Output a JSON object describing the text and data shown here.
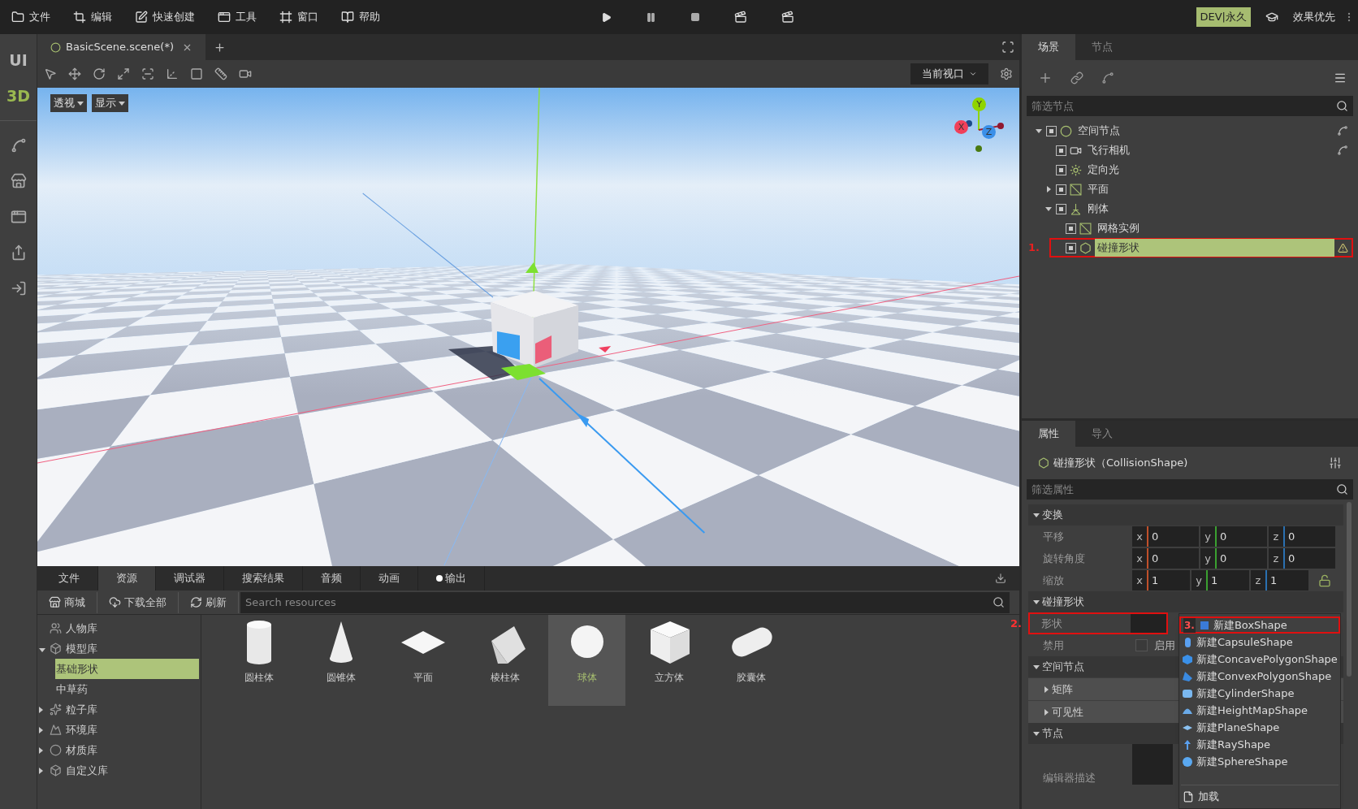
{
  "menu_bar": {
    "items": [
      {
        "label": "文件"
      },
      {
        "label": "编辑"
      },
      {
        "label": "快速创建"
      },
      {
        "label": "工具"
      },
      {
        "label": "窗口"
      },
      {
        "label": "帮助"
      }
    ],
    "license_badge": "DEV|永久",
    "quality": "效果优先"
  },
  "mode_rail": [
    {
      "label": "UI",
      "selected": false
    },
    {
      "label": "3D",
      "selected": true
    }
  ],
  "editor": {
    "tabs": [
      {
        "label": "BasicScene.scene(*)",
        "selected": true
      }
    ],
    "viewport_select": "当前视口",
    "view_buttons": [
      "透视",
      "显示"
    ],
    "gizmo_axes": [
      {
        "label": "Y",
        "color": "#8fd400"
      },
      {
        "label": "X",
        "color": "#f0405a"
      },
      {
        "label": "Z",
        "color": "#3a8fe8"
      }
    ]
  },
  "bottom_panel": {
    "tabs": [
      {
        "label": "文件",
        "selected": false,
        "unread": false
      },
      {
        "label": "资源",
        "selected": true,
        "unread": false
      },
      {
        "label": "调试器",
        "selected": false,
        "unread": false
      },
      {
        "label": "搜索结果",
        "selected": false,
        "unread": false
      },
      {
        "label": "音频",
        "selected": false,
        "unread": false
      },
      {
        "label": "动画",
        "selected": false,
        "unread": false
      },
      {
        "label": "输出",
        "selected": false,
        "unread": true
      }
    ],
    "toolbar": [
      {
        "label": "商城"
      },
      {
        "label": "下载全部"
      },
      {
        "label": "刷新"
      }
    ],
    "search": {
      "placeholder": "Search resources"
    },
    "library": [
      {
        "label": "人物库",
        "selected": false
      },
      {
        "label": "模型库",
        "expanded": true,
        "selected": false,
        "children": [
          {
            "label": "基础形状",
            "selected": true
          },
          {
            "label": "中草药",
            "selected": false
          }
        ]
      },
      {
        "label": "粒子库",
        "expanded": false,
        "selected": false
      },
      {
        "label": "环境库",
        "expanded": false,
        "selected": false
      },
      {
        "label": "材质库",
        "expanded": false,
        "selected": false
      },
      {
        "label": "自定义库",
        "expanded": false,
        "selected": false
      }
    ],
    "assets": [
      {
        "label": "圆柱体",
        "kind": "cylinder",
        "selected": false
      },
      {
        "label": "圆锥体",
        "kind": "cone",
        "selected": false
      },
      {
        "label": "平面",
        "kind": "plane",
        "selected": false
      },
      {
        "label": "棱柱体",
        "kind": "prism",
        "selected": false
      },
      {
        "label": "球体",
        "kind": "sphere",
        "selected": true
      },
      {
        "label": "立方体",
        "kind": "cube",
        "selected": false
      },
      {
        "label": "胶囊体",
        "kind": "capsule",
        "selected": false
      }
    ]
  },
  "scene_panel": {
    "tabs": [
      {
        "label": "场景",
        "selected": true
      },
      {
        "label": "节点",
        "selected": false
      }
    ],
    "filter": {
      "placeholder": "筛选节点"
    },
    "tree": [
      {
        "label": "空间节点",
        "kind": "spatial",
        "visible": true,
        "expanded": true,
        "selected": false,
        "linked": true,
        "children": [
          {
            "label": "飞行相机",
            "kind": "camera",
            "visible": true,
            "selected": false,
            "linked": true
          },
          {
            "label": "定向光",
            "kind": "light",
            "visible": true,
            "selected": false,
            "linked": false
          },
          {
            "label": "平面",
            "kind": "mesh",
            "visible": true,
            "expanded": false,
            "selected": false,
            "linked": false
          },
          {
            "label": "刚体",
            "kind": "body",
            "visible": true,
            "expanded": true,
            "selected": false,
            "linked": false,
            "children": [
              {
                "label": "网格实例",
                "kind": "mesh",
                "visible": true,
                "selected": false,
                "linked": false,
                "warning": false
              },
              {
                "label": "碰撞形状",
                "kind": "shape",
                "visible": true,
                "selected": true,
                "linked": false,
                "warning": true,
                "marker": "1."
              }
            ]
          }
        ]
      }
    ]
  },
  "properties_panel": {
    "tabs": [
      {
        "label": "属性",
        "selected": true
      },
      {
        "label": "导入",
        "selected": false
      }
    ],
    "title": "碰撞形状（CollisionShape)",
    "filter": {
      "placeholder": "筛选属性"
    },
    "sections": [
      {
        "title": "变换",
        "expanded": true,
        "rows": [
          {
            "kind": "vector3",
            "label": "平移",
            "linked": false,
            "fields": [
              {
                "axis": "x",
                "value": "0",
                "color": "#c0502a"
              },
              {
                "axis": "y",
                "value": "0",
                "color": "#3aa030"
              },
              {
                "axis": "z",
                "value": "0",
                "color": "#2a70b0"
              }
            ]
          },
          {
            "kind": "vector3",
            "label": "旋转角度",
            "linked": false,
            "fields": [
              {
                "axis": "x",
                "value": "0",
                "color": "#c0502a"
              },
              {
                "axis": "y",
                "value": "0",
                "color": "#3aa030"
              },
              {
                "axis": "z",
                "value": "0",
                "color": "#2a70b0"
              }
            ]
          },
          {
            "kind": "vector3",
            "label": "缩放",
            "linked": true,
            "fields": [
              {
                "axis": "x",
                "value": "1",
                "color": "#c0502a"
              },
              {
                "axis": "y",
                "value": "1",
                "color": "#3aa030"
              },
              {
                "axis": "z",
                "value": "1",
                "color": "#2a70b0"
              }
            ]
          }
        ]
      },
      {
        "title": "碰撞形状",
        "expanded": true,
        "rows": [
          {
            "kind": "resource",
            "label": "形状",
            "marker": "2."
          },
          {
            "kind": "checkbox",
            "label": "禁用",
            "checked": false,
            "text": "启用"
          }
        ]
      },
      {
        "title": "空间节点",
        "expanded": true,
        "rows": [
          {
            "kind": "group",
            "label": "矩阵",
            "expanded": false
          },
          {
            "kind": "group",
            "label": "可见性",
            "expanded": false
          }
        ]
      },
      {
        "title": "节点",
        "expanded": true,
        "rows": [
          {
            "kind": "text",
            "label": "编辑器描述"
          }
        ]
      }
    ]
  },
  "shape_menu": {
    "items": [
      {
        "label": "新建BoxShape",
        "kind": "box",
        "marker": "3."
      },
      {
        "label": "新建CapsuleShape",
        "kind": "capsule"
      },
      {
        "label": "新建ConcavePolygonShape",
        "kind": "concave"
      },
      {
        "label": "新建ConvexPolygonShape",
        "kind": "convex"
      },
      {
        "label": "新建CylinderShape",
        "kind": "cylinder"
      },
      {
        "label": "新建HeightMapShape",
        "kind": "heightmap"
      },
      {
        "label": "新建PlaneShape",
        "kind": "plane"
      },
      {
        "label": "新建RayShape",
        "kind": "ray"
      },
      {
        "label": "新建SphereShape",
        "kind": "sphere"
      }
    ],
    "load": "加载"
  }
}
